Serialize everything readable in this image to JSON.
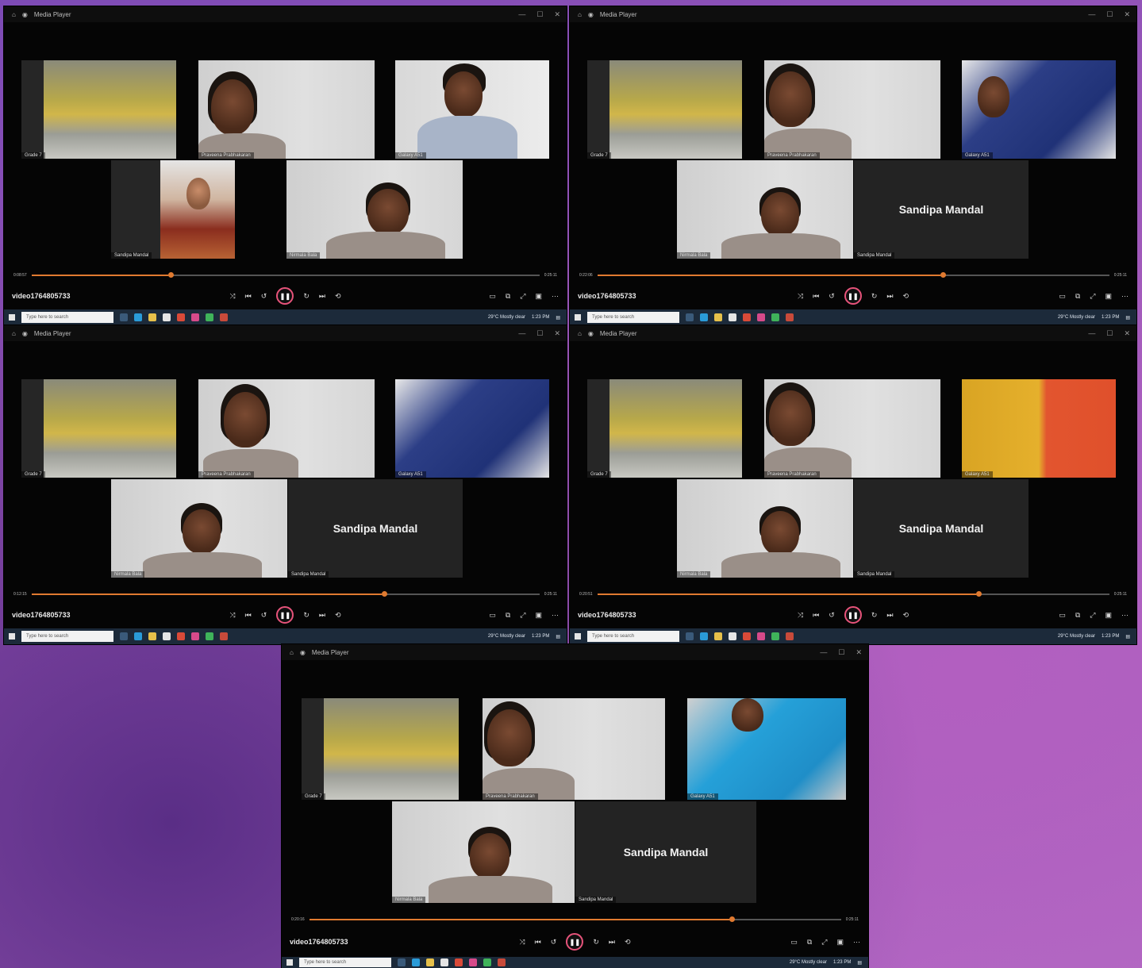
{
  "players": [
    {
      "app_title": "Media Player",
      "filename": "video1764805733",
      "time_current": "0:08:57",
      "time_total": "0:25:11",
      "progress": 0.3,
      "participants": {
        "grade7": "Grade 7",
        "praveena": "Praveena Prabhakaran",
        "galaxy": "Galaxy A51",
        "sandipa": "Sandipa Mandal",
        "nirmala": "Nirmala Bala",
        "sandipa_big": "Sandipa Mandal"
      },
      "galaxy_scene": "room",
      "show_sandipa_video": true
    },
    {
      "app_title": "Media Player",
      "filename": "video1764805733",
      "time_current": "0:22:06",
      "time_total": "0:25:11",
      "progress": 0.7,
      "participants": {
        "grade7": "Grade 7",
        "praveena": "Praveena Prabhakaran",
        "galaxy": "Galaxy A51",
        "sandipa": "Sandipa Mandal",
        "nirmala": "Nirmala Bala",
        "sandipa_big": "Sandipa Mandal"
      },
      "galaxy_scene": "navy",
      "show_sandipa_video": false
    },
    {
      "app_title": "Media Player",
      "filename": "video1764805733",
      "time_current": "0:12:15",
      "time_total": "0:25:11",
      "progress": 0.69,
      "participants": {
        "grade7": "Grade 7",
        "praveena": "Praveena Prabhakaran",
        "galaxy": "Galaxy A51",
        "sandipa": "Sandipa Mandal",
        "nirmala": "Nirmala Bala",
        "sandipa_big": "Sandipa Mandal"
      },
      "galaxy_scene": "navy",
      "show_sandipa_video": false
    },
    {
      "app_title": "Media Player",
      "filename": "video1764805733",
      "time_current": "0:20:51",
      "time_total": "0:25:11",
      "progress": 0.74,
      "participants": {
        "grade7": "Grade 7",
        "praveena": "Praveena Prabhakaran",
        "galaxy": "Galaxy A51",
        "sandipa": "Sandipa Mandal",
        "nirmala": "Nirmala Bala",
        "sandipa_big": "Sandipa Mandal"
      },
      "galaxy_scene": "yellow",
      "show_sandipa_video": false
    },
    {
      "app_title": "Media Player",
      "filename": "video1764805733",
      "time_current": "0:20:16",
      "time_total": "0:25:11",
      "progress": 0.78,
      "participants": {
        "grade7": "Grade 7",
        "praveena": "Praveena Prabhakaran",
        "galaxy": "Galaxy A51",
        "sandipa": "Sandipa Mandal",
        "nirmala": "Nirmala Bala",
        "sandipa_big": "Sandipa Mandal"
      },
      "galaxy_scene": "cyan",
      "show_sandipa_video": false
    }
  ],
  "taskbar": {
    "search_placeholder": "Type here to search",
    "weather": "29°C Mostly clear",
    "time": "1:23 PM"
  },
  "colors": {
    "accent": "#e07a30",
    "play_ring": "#e6537a"
  }
}
